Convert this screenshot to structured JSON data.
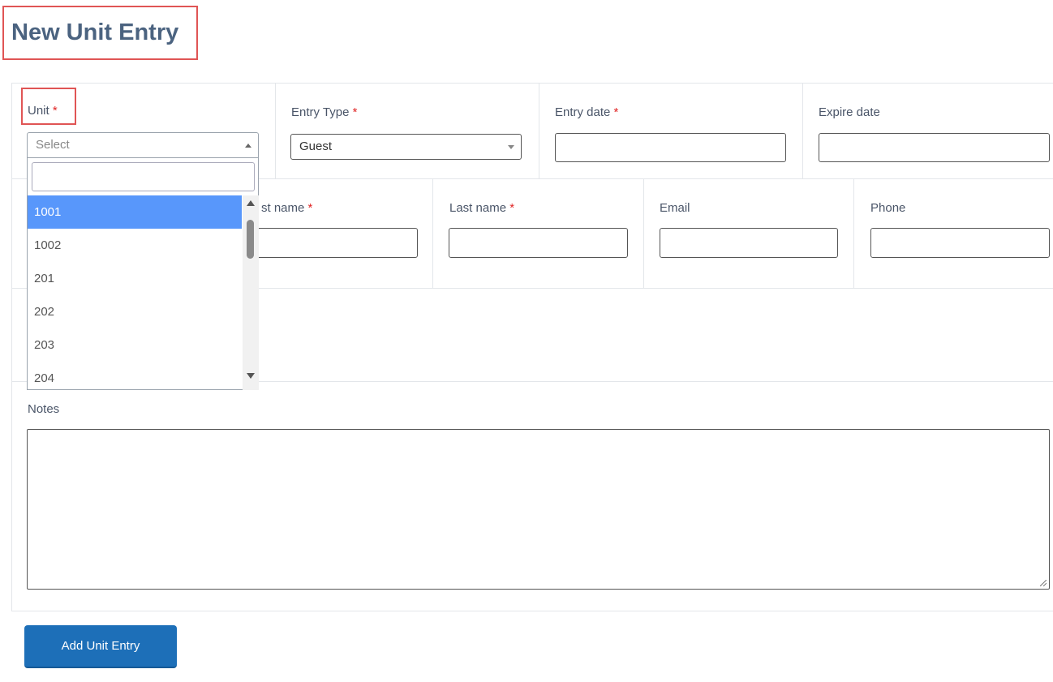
{
  "page": {
    "title": "New Unit Entry"
  },
  "unit": {
    "label": "Unit",
    "required_mark": "*",
    "placeholder": "Select",
    "search_value": "",
    "options": [
      "1001",
      "1002",
      "201",
      "202",
      "203",
      "204"
    ],
    "highlighted_option": "1001"
  },
  "entry_type": {
    "label": "Entry Type",
    "required_mark": "*",
    "value": "Guest"
  },
  "entry_date": {
    "label": "Entry date",
    "required_mark": "*",
    "value": ""
  },
  "expire_date": {
    "label": "Expire date",
    "value": ""
  },
  "first_name": {
    "label_visible": "st name",
    "required_mark": "*",
    "value": ""
  },
  "last_name": {
    "label": "Last name",
    "required_mark": "*",
    "value": ""
  },
  "email": {
    "label": "Email",
    "value": ""
  },
  "phone": {
    "label": "Phone",
    "value": ""
  },
  "notes": {
    "label": "Notes",
    "value": ""
  },
  "submit": {
    "label": "Add Unit Entry"
  },
  "colors": {
    "accent": "#1d6fb8",
    "highlight_border": "#e05555",
    "required": "#e02424",
    "option_selected": "#5897fb"
  }
}
